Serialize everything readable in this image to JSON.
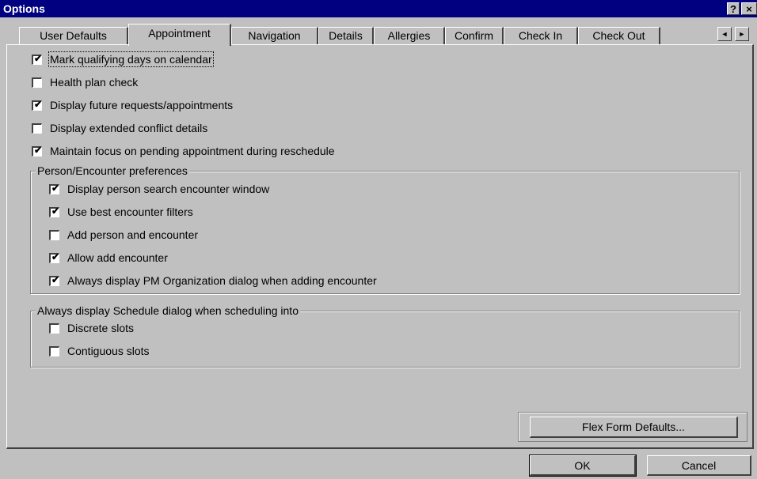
{
  "window": {
    "title": "Options",
    "help_glyph": "?",
    "close_glyph": "×"
  },
  "tabs": [
    {
      "label": "User Defaults"
    },
    {
      "label": "Appointment"
    },
    {
      "label": "Navigation"
    },
    {
      "label": "Details"
    },
    {
      "label": "Allergies"
    },
    {
      "label": "Confirm"
    },
    {
      "label": "Check In"
    },
    {
      "label": "Check Out"
    }
  ],
  "tab_scroll": {
    "left": "◄",
    "right": "►"
  },
  "options": [
    {
      "label": "Mark qualifying days on calendar",
      "checked": true
    },
    {
      "label": "Health plan check",
      "checked": false
    },
    {
      "label": "Display future requests/appointments",
      "checked": true
    },
    {
      "label": "Display extended conflict details",
      "checked": false
    },
    {
      "label": "Maintain focus on pending appointment during reschedule",
      "checked": true
    }
  ],
  "person_group": {
    "title": "Person/Encounter preferences",
    "items": [
      {
        "label": "Display person search encounter window",
        "checked": true
      },
      {
        "label": "Use best encounter filters",
        "checked": true
      },
      {
        "label": "Add person and encounter",
        "checked": false
      },
      {
        "label": "Allow add encounter",
        "checked": true
      },
      {
        "label": "Always display PM Organization dialog when adding encounter",
        "checked": true
      }
    ]
  },
  "schedule_group": {
    "title": "Always display Schedule dialog when scheduling into",
    "items": [
      {
        "label": "Discrete slots",
        "checked": false
      },
      {
        "label": "Contiguous slots",
        "checked": false
      }
    ]
  },
  "check_glyph": "✔",
  "buttons": {
    "flex_form": "Flex Form Defaults...",
    "ok": "OK",
    "cancel": "Cancel"
  }
}
